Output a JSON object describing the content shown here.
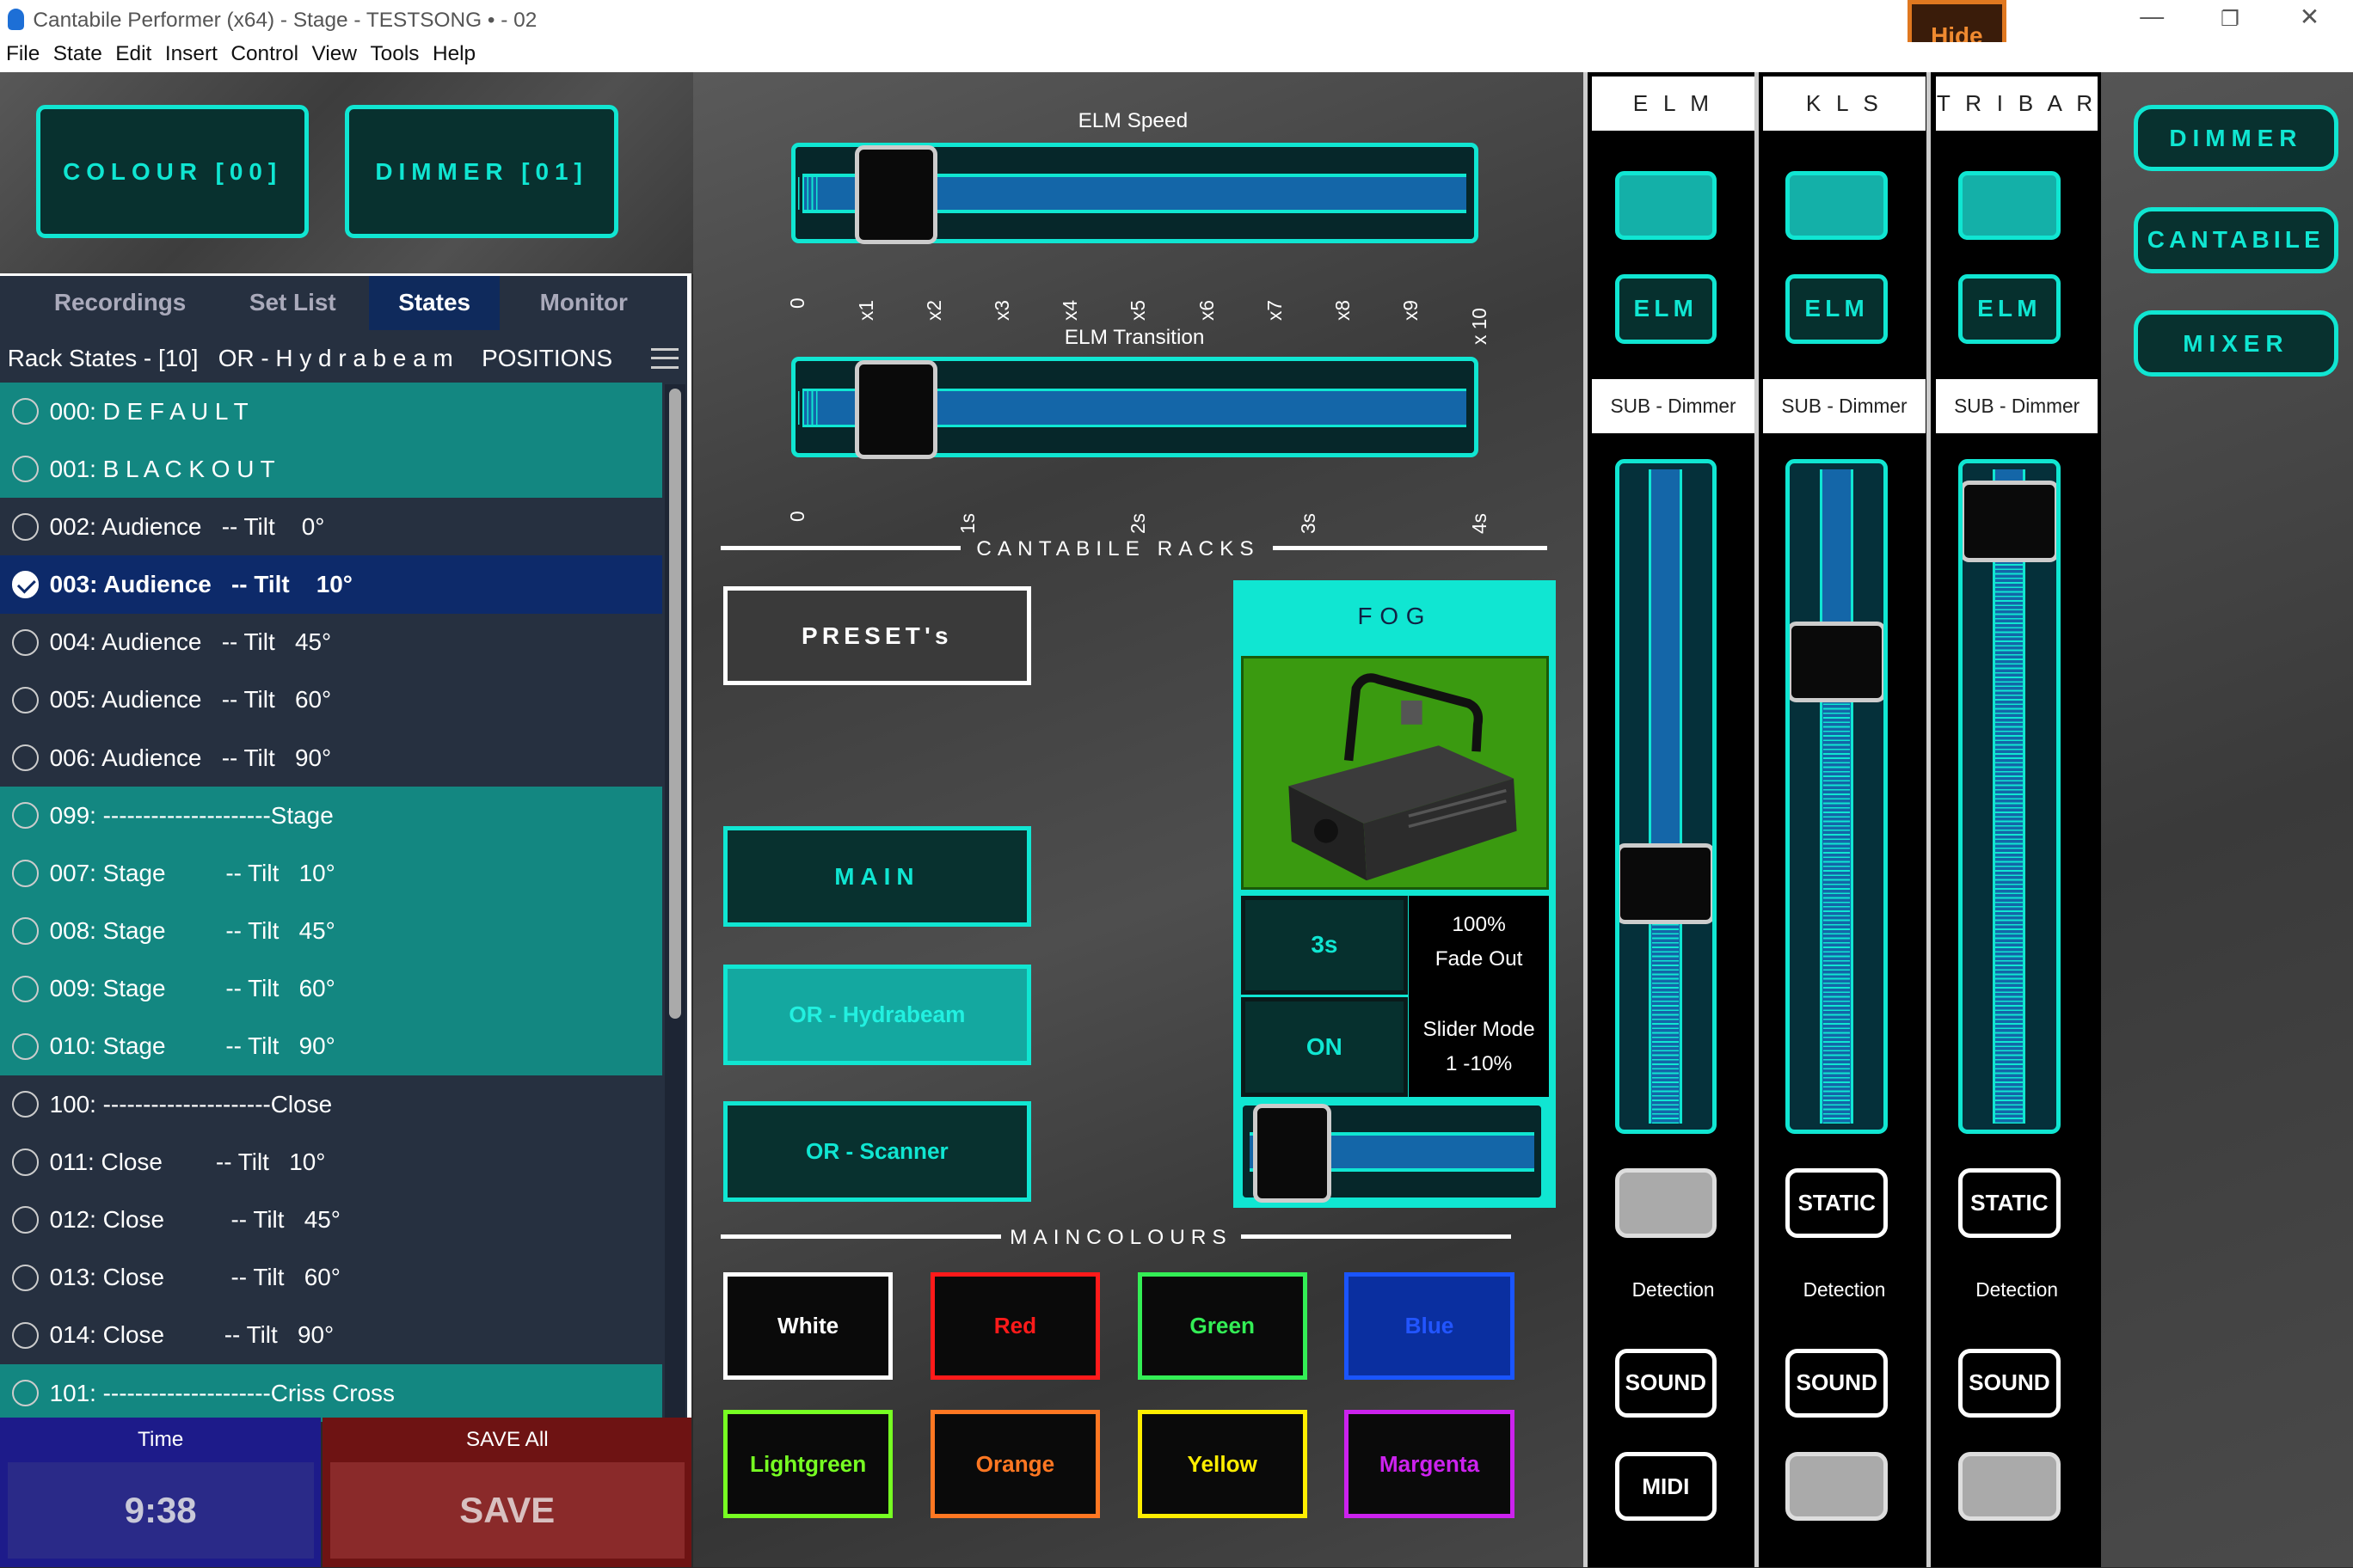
{
  "window": {
    "title": "Cantabile Performer (x64) - Stage - TESTSONG • - 02",
    "hide": "Hide",
    "min": "—",
    "restore": "❐",
    "close": "✕"
  },
  "menu": [
    "File",
    "State",
    "Edit",
    "Insert",
    "Control",
    "View",
    "Tools",
    "Help"
  ],
  "top_buttons": {
    "colour": "COLOUR [00]",
    "dimmer": "DIMMER [01]"
  },
  "tabs": [
    "Recordings",
    "Set List",
    "States",
    "Monitor"
  ],
  "active_tab": "States",
  "rack_header": {
    "title": "Rack States - [10]   OR - H y d r a b e a m",
    "positions": "POSITIONS"
  },
  "states": [
    {
      "label": "000: D E F A U L T",
      "style": "teal"
    },
    {
      "label": "001: B L A C K O U T",
      "style": "teal"
    },
    {
      "label": "002: Audience   -- Tilt    0°",
      "style": "dark"
    },
    {
      "label": "003: Audience   -- Tilt    10°",
      "style": "sel"
    },
    {
      "label": "004: Audience   -- Tilt   45°",
      "style": "dark"
    },
    {
      "label": "005: Audience   -- Tilt   60°",
      "style": "dark"
    },
    {
      "label": "006: Audience   -- Tilt   90°",
      "style": "dark"
    },
    {
      "label": "099: ---------------------Stage",
      "style": "teal"
    },
    {
      "label": "007: Stage         -- Tilt   10°",
      "style": "teal"
    },
    {
      "label": "008: Stage         -- Tilt   45°",
      "style": "teal"
    },
    {
      "label": "009: Stage         -- Tilt   60°",
      "style": "teal"
    },
    {
      "label": "010: Stage         -- Tilt   90°",
      "style": "teal"
    },
    {
      "label": "100: ---------------------Close",
      "style": "dark"
    },
    {
      "label": "011: Close        -- Tilt   10°",
      "style": "dark"
    },
    {
      "label": "012: Close          -- Tilt   45°",
      "style": "dark"
    },
    {
      "label": "013: Close          -- Tilt   60°",
      "style": "dark"
    },
    {
      "label": "014: Close         -- Tilt   90°",
      "style": "dark"
    },
    {
      "label": "101: ---------------------Criss Cross",
      "style": "teal"
    }
  ],
  "time": {
    "label": "Time",
    "value": "9:38"
  },
  "save": {
    "label": "SAVE All",
    "button": "SAVE"
  },
  "elm_speed": {
    "title": "ELM Speed",
    "ticks": [
      "0",
      "x1",
      "x2",
      "x3",
      "x4",
      "x5",
      "x6",
      "x7",
      "x8",
      "x9",
      "x 10"
    ],
    "value": 0.1
  },
  "elm_transition": {
    "title": "ELM Transition",
    "ticks": [
      "0",
      "1s",
      "2s",
      "3s",
      "4s"
    ],
    "value": 0.1
  },
  "cantabile_racks": "CANTABILE RACKS",
  "rack_buttons": {
    "presets": "PRESET's",
    "main": "MAIN",
    "hydrabeam": "OR - Hydrabeam",
    "scanner": "OR - Scanner"
  },
  "fog": {
    "title": "FOG",
    "time": "3s",
    "on": "ON",
    "fade": "100%\nFade Out",
    "mode": "Slider Mode\n1 -10%",
    "value": 0.05
  },
  "maincolours": {
    "title": "MAINCOLOURS",
    "items": [
      {
        "label": "White",
        "color": "#ffffff"
      },
      {
        "label": "Red",
        "color": "#ff1a1a"
      },
      {
        "label": "Green",
        "color": "#33ee55"
      },
      {
        "label": "Blue",
        "color": "#1a55ff"
      },
      {
        "label": "Lightgreen",
        "color": "#77ff22"
      },
      {
        "label": "Orange",
        "color": "#ff7722"
      },
      {
        "label": "Yellow",
        "color": "#ffee00"
      },
      {
        "label": "Margenta",
        "color": "#cc22ee"
      }
    ]
  },
  "strips": [
    {
      "name": "E L M",
      "elm": "ELM",
      "sub": "SUB - Dimmer",
      "level": 0.35,
      "btn1": "",
      "detection": "Detection",
      "sound": "SOUND",
      "btn3": "MIDI"
    },
    {
      "name": "K L S",
      "elm": "ELM",
      "sub": "SUB - Dimmer",
      "level": 0.73,
      "btn1": "STATIC",
      "detection": "Detection",
      "sound": "SOUND",
      "btn3": ""
    },
    {
      "name": "T R I B A R",
      "elm": "ELM",
      "sub": "SUB - Dimmer",
      "level": 0.97,
      "btn1": "STATIC",
      "detection": "Detection",
      "sound": "SOUND",
      "btn3": ""
    }
  ],
  "right_buttons": [
    "DIMMER",
    "CANTABILE",
    "MIXER"
  ]
}
